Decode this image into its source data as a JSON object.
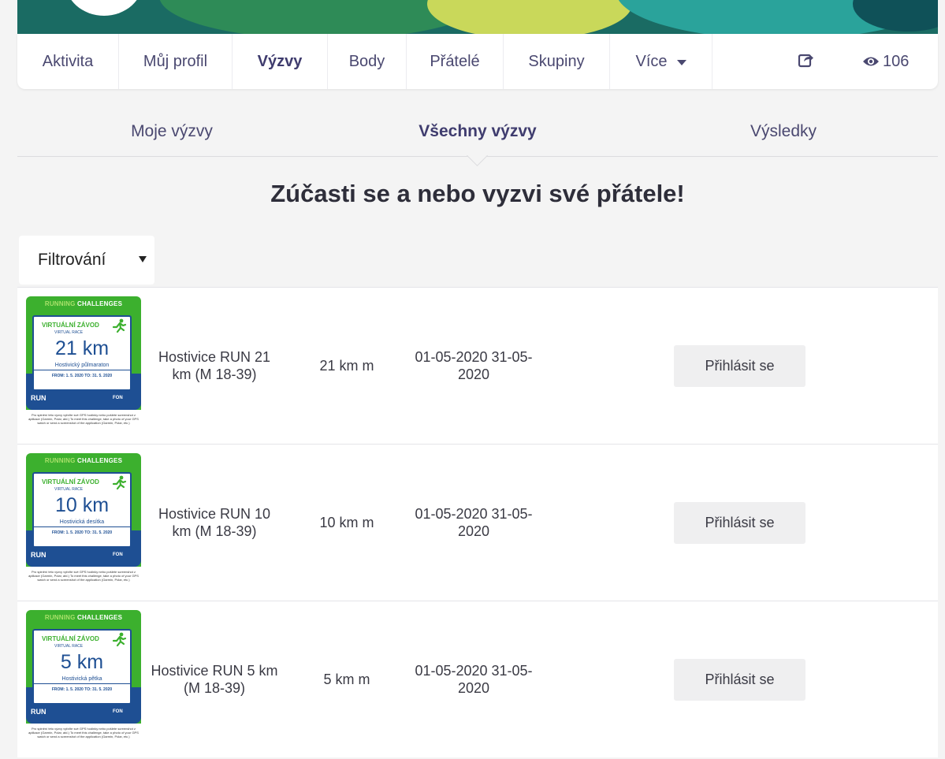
{
  "nav": {
    "items": [
      "Aktivita",
      "Můj profil",
      "Výzvy",
      "Body",
      "Přátelé",
      "Skupiny",
      "Více"
    ],
    "active_index": 2,
    "views_count": "106"
  },
  "subtabs": {
    "items": [
      "Moje výzvy",
      "Všechny výzvy",
      "Výsledky"
    ],
    "active_index": 1
  },
  "headline": "Zúčasti se a nebo vyzvi své přátele!",
  "filter": {
    "label": "Filtrování"
  },
  "thumbnail": {
    "top_label_a": "RUNNING",
    "top_label_b": "CHALLENGES",
    "virtual_label": "VIRTUÁLNÍ ZÁVOD",
    "virtual_sub": "VIRTUAL RACE",
    "dates": "FROM: 1. 5. 2020    TO: 31. 5. 2020",
    "logo_left": "RUN",
    "logo_right": "FON",
    "fine_print": "Pro splnění této výzvy vyfoťte své GPS hodinky nebo pošlete screenshot z aplikace (Garmin, Polar, atd.) To meet this challenge, take a photo of your GPS watch or send a screenshot of the application (Garmin, Polar, etc.)"
  },
  "challenges": [
    {
      "thumb_distance": "21 km",
      "thumb_subtitle": "Hostivický půlmaraton",
      "name": "Hostivice RUN 21 km (M 18-39)",
      "distance": "21 km m",
      "dates": "01-05-2020 31-05-2020",
      "button": "Přihlásit se"
    },
    {
      "thumb_distance": "10 km",
      "thumb_subtitle": "Hostivická desítka",
      "name": "Hostivice RUN 10 km (M 18-39)",
      "distance": "10 km m",
      "dates": "01-05-2020 31-05-2020",
      "button": "Přihlásit se"
    },
    {
      "thumb_distance": "5 km",
      "thumb_subtitle": "Hostivická pětka",
      "name": "Hostivice RUN 5 km (M 18-39)",
      "distance": "5 km m",
      "dates": "01-05-2020 31-05-2020",
      "button": "Přihlásit se"
    }
  ],
  "colors": {
    "accent": "#3f3c6e",
    "thumb_green": "#3cb02e",
    "thumb_blue": "#1e4f93",
    "button_bg": "#efeff0"
  }
}
